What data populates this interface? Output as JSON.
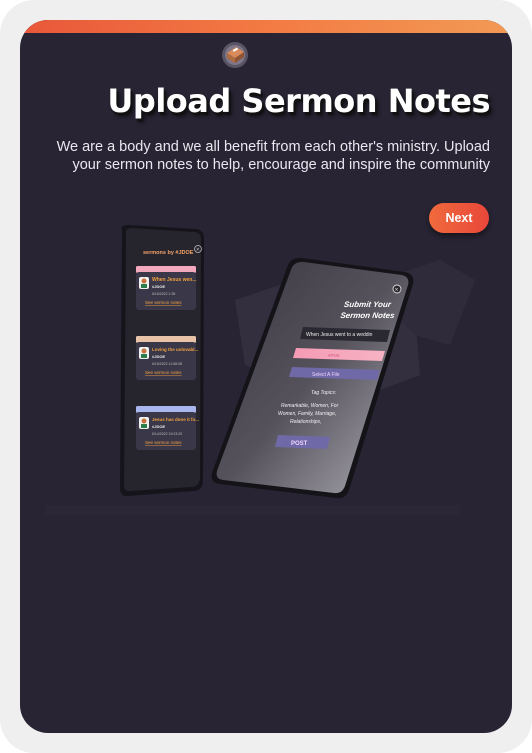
{
  "onboarding": {
    "title": "Upload Sermon Notes",
    "subtitle": "We are a body and we all benefit from each other's ministry. Upload your sermon notes to help, encourage and inspire the community",
    "next_label": "Next"
  },
  "illustration": {
    "back_phone": {
      "header": "sermons by #JDOE",
      "cards": [
        {
          "color": "#f3a9bd",
          "title": "When Jesus wen...",
          "author": "#JDOE",
          "date": "6/16/2022 2:35",
          "link": "See sermon notes"
        },
        {
          "color": "#e9c3a8",
          "title": "Loving the unlovabl...",
          "author": "#JDOE",
          "date": "6/15/2022 11:58:08",
          "link": "See sermon notes"
        },
        {
          "color": "#a9b6ef",
          "title": "Jesus has done it fo...",
          "author": "#JDOE",
          "date": "6/14/2022 19:23:20",
          "link": "See sermon notes"
        }
      ]
    },
    "front_phone": {
      "title_line1": "Submit Your",
      "title_line2": "Sermon Notes",
      "input_value": "When Jesus went to a weddin",
      "pink_field_placeholder": "#PNK",
      "file_button": "Select A File",
      "tag_label": "Tag Topics:",
      "tags_line1": "Remarkable, Women, For",
      "tags_line2": "Women, Family, Marriage,",
      "tags_line3": "Relationships,",
      "post_button": "POST"
    }
  },
  "colors": {
    "background": "#282433",
    "accent": "#f06a3c",
    "frame": "#efefef"
  }
}
